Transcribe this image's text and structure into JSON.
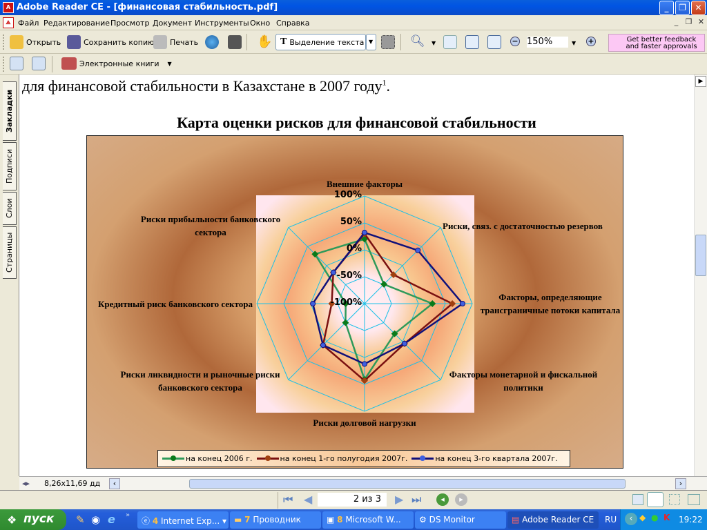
{
  "window": {
    "title": "Adobe Reader CE - [финансовая стабильность.pdf]"
  },
  "menu": [
    "Файл",
    "Редактирование",
    "Просмотр",
    "Документ",
    "Инструменты",
    "Окно",
    "Справка"
  ],
  "toolbar": {
    "open": "Открыть",
    "save_copy": "Сохранить копию",
    "print": "Печать",
    "select_text": "Выделение текста",
    "zoom_value": "150%",
    "promo_line1": "Get better feedback",
    "promo_line2": "and faster approvals",
    "ebooks": "Электронные книги"
  },
  "side_tabs": [
    "Закладки",
    "Подписи",
    "Слои",
    "Страницы"
  ],
  "document": {
    "text_line": "для финансовой стабильности в Казахстане в 2007 году",
    "footnote": "1",
    "text_end": "."
  },
  "status": {
    "page_size": "8,26x11,69 дд",
    "page_indicator": "2 из 3"
  },
  "chart_data": {
    "type": "radar",
    "title": "Карта оценки рисков для финансовой стабильности",
    "axes": [
      "Внешние факторы",
      "Риски, связ. с достаточностью резервов",
      "Факторы, определяющие трансграничные потоки капитала",
      "Факторы монетарной и фискальной политики",
      "Риски долговой нагрузки",
      "Риски ликвидности и рыночные риски банковского сектора",
      "Кредитный риск банковского сектора",
      "Риски прибыльности банковского сектора"
    ],
    "axis_label_lines": [
      [
        "Внешние факторы"
      ],
      [
        "Риски, связ. с достаточностью резервов"
      ],
      [
        "Факторы, определяющие",
        "трансграничные потоки капитала"
      ],
      [
        "Факторы монетарной и фискальной",
        "политики"
      ],
      [
        "Риски долговой нагрузки"
      ],
      [
        "Риски ликвидности и рыночные риски",
        "банковского сектора"
      ],
      [
        "Кредитный риск банковского сектора"
      ],
      [
        "Риски прибыльности банковского",
        "сектора"
      ]
    ],
    "ticks": [
      "100%",
      "50%",
      "0%",
      "-50%",
      "-100%"
    ],
    "tick_values": [
      100,
      50,
      0,
      -50,
      -100
    ],
    "range": [
      -100,
      100
    ],
    "legend_position": "bottom",
    "series": [
      {
        "name": "на конец 2006 г.",
        "color": "#2e9a5a",
        "marker": "#0a7a1a",
        "values": [
          20,
          -49,
          26,
          -21,
          41,
          -50,
          -65,
          30
        ]
      },
      {
        "name": "на конец 1-го полугодия 2007г.",
        "color": "#7a1010",
        "marker": "#a04010",
        "values": [
          30,
          -24,
          63,
          5,
          43,
          9,
          -39,
          -18
        ]
      },
      {
        "name": "на конец 3-го квартала 2007г.",
        "color": "#10107a",
        "marker": "#4060e0",
        "values": [
          32,
          40,
          82,
          5,
          12,
          9,
          -4,
          -18
        ]
      }
    ]
  },
  "taskbar": {
    "start": "пуск",
    "tasks": [
      {
        "count": "4",
        "label": "Internet Exp..."
      },
      {
        "count": "7",
        "label": "Проводник"
      },
      {
        "count": "8",
        "label": "Microsoft W..."
      },
      {
        "count": "",
        "label": "DS Monitor"
      },
      {
        "count": "",
        "label": "Adobe Reader CE"
      }
    ],
    "lang": "RU",
    "clock": "19:22"
  }
}
